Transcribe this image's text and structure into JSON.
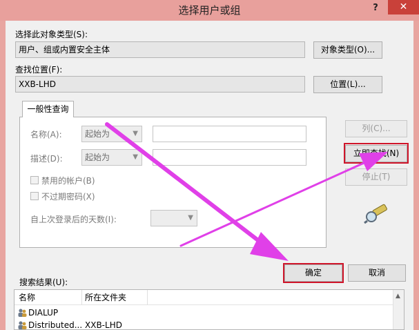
{
  "window": {
    "title": "选择用户或组",
    "help": "?",
    "close": "✕"
  },
  "object_type": {
    "label": "选择此对象类型(S):",
    "value": "用户、组或内置安全主体",
    "button": "对象类型(O)..."
  },
  "location": {
    "label": "查找位置(F):",
    "value": "XXB-LHD",
    "button": "位置(L)..."
  },
  "tab": {
    "label": "一般性查询"
  },
  "query": {
    "name_label": "名称(A):",
    "name_mode": "起始为",
    "desc_label": "描述(D):",
    "desc_mode": "起始为",
    "disabled_accounts": "禁用的帐户(B)",
    "non_expiring_pw": "不过期密码(X)",
    "days_since_login": "自上次登录后的天数(I):"
  },
  "side_buttons": {
    "columns": "列(C)...",
    "find_now": "立即查找(N)",
    "stop": "停止(T)"
  },
  "dialog_buttons": {
    "ok": "确定",
    "cancel": "取消"
  },
  "results": {
    "label": "搜索结果(U):",
    "columns": [
      "名称",
      "所在文件夹"
    ],
    "rows": [
      {
        "name": "DIALUP",
        "folder": ""
      },
      {
        "name": "Distributed...",
        "folder": "XXB-LHD"
      }
    ]
  },
  "colors": {
    "titlebar": "#e8a09c",
    "close": "#c9413a",
    "highlight": "#d0152a",
    "annotation_arrow": "#e040e8"
  }
}
